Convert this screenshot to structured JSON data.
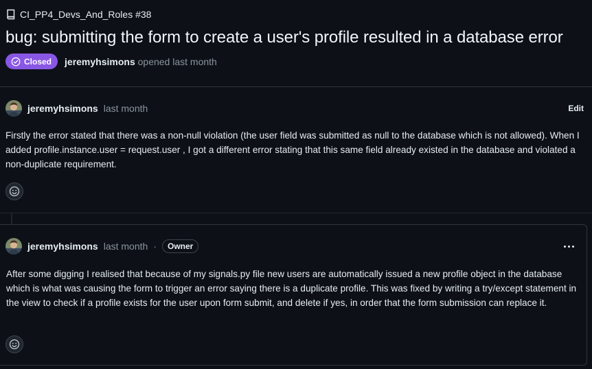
{
  "header": {
    "repo_ref": "CI_PP4_Devs_And_Roles #38",
    "title": "bug: submitting the form to create a user's profile resulted in a database error",
    "state": "Closed",
    "author": "jeremyhsimons",
    "opened_text": "opened last month",
    "state_color": "#8957e5"
  },
  "comments": [
    {
      "author": "jeremyhsimons",
      "time": "last month",
      "action": "Edit",
      "body": "Firstly the error stated that there was a non-null violation (the user field was submitted as null to the database which is not allowed). When I added profile.instance.user = request.user , I got a different error stating that this same field already existed in the database and violated a non-duplicate requirement.",
      "reaction_icon": "smiley-icon"
    },
    {
      "author": "jeremyhsimons",
      "time": "last month",
      "separator": "·",
      "badge": "Owner",
      "menu_icon": "kebab-horizontal-icon",
      "body": "After some digging I realised that because of my signals.py file new users are automatically issued a new profile object in the database which is what was causing the form to trigger an error saying there is a duplicate profile. This was fixed by writing a try/except statement in the view to check if a profile exists for the user upon form submit, and delete if yes, in order that the form submission can replace it.",
      "reaction_icon": "smiley-icon"
    }
  ]
}
